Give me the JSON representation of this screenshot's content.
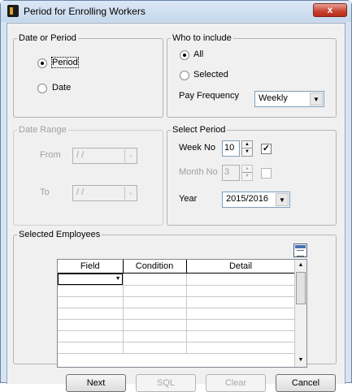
{
  "window": {
    "title": "Period for Enrolling Workers",
    "close_glyph": "x"
  },
  "date_or_period": {
    "legend": "Date or Period",
    "options": [
      {
        "label": "Period",
        "selected": true
      },
      {
        "label": "Date",
        "selected": false
      }
    ]
  },
  "who_to_include": {
    "legend": "Who to include",
    "options": [
      {
        "label": "All",
        "selected": true
      },
      {
        "label": "Selected",
        "selected": false
      }
    ],
    "pay_frequency_label": "Pay Frequency",
    "pay_frequency_value": "Weekly"
  },
  "date_range": {
    "legend": "Date Range",
    "from_label": "From",
    "from_value": "/ /",
    "to_label": "To",
    "to_value": "/ /"
  },
  "select_period": {
    "legend": "Select Period",
    "week_no_label": "Week No",
    "week_no_value": "10",
    "week_checked": true,
    "month_no_label": "Month No",
    "month_no_value": "3",
    "month_checked": false,
    "year_label": "Year",
    "year_value": "2015/2016"
  },
  "selected_employees": {
    "legend": "Selected Employees",
    "columns": [
      "Field",
      "Condition",
      "Detail"
    ],
    "row_count": 7
  },
  "buttons": {
    "next": "Next",
    "sql": "SQL",
    "clear": "Clear",
    "cancel": "Cancel"
  },
  "icons": {
    "app": "app-icon",
    "export": "export-grid-icon"
  }
}
